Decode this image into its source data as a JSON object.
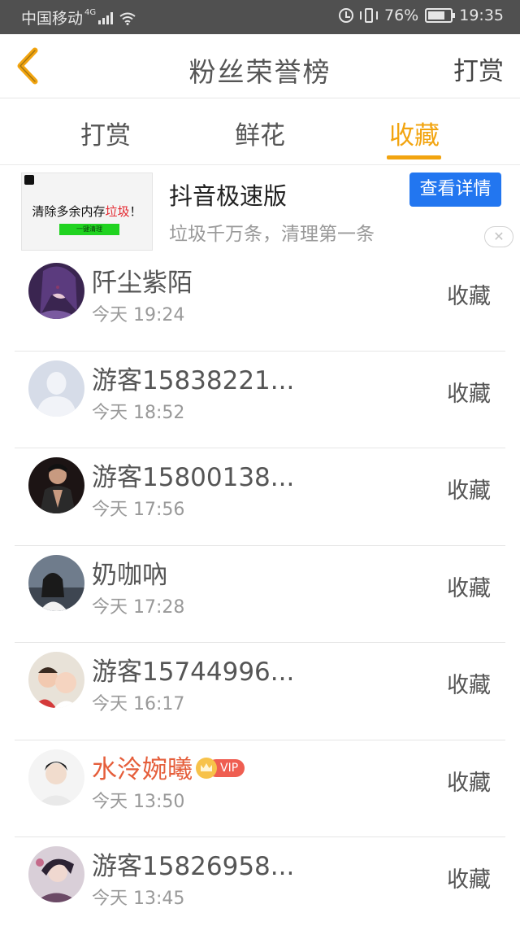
{
  "status_bar": {
    "carrier": "中国移动",
    "network": "4G",
    "battery": "76%",
    "battery_level": 0.76,
    "time": "19:35"
  },
  "header": {
    "title": "粉丝荣誉榜",
    "right_action": "打赏"
  },
  "tabs": [
    {
      "label": "打赏",
      "active": false
    },
    {
      "label": "鲜花",
      "active": false
    },
    {
      "label": "收藏",
      "active": true
    }
  ],
  "ad": {
    "image_text_main": "清除多余内存",
    "image_text_highlight": "垃圾",
    "image_text_suffix": "！",
    "image_button": "一键清理",
    "title": "抖音极速版",
    "subtitle": "垃圾千万条，清理第一条",
    "button": "查看详情"
  },
  "list": [
    {
      "name": "阡尘紫陌",
      "time": "今天 19:24",
      "action": "收藏",
      "vip": false,
      "avatar": "anime-purple-avatar"
    },
    {
      "name": "游客15838221...",
      "time": "今天 18:52",
      "action": "收藏",
      "vip": false,
      "avatar": "default-user-avatar"
    },
    {
      "name": "游客15800138...",
      "time": "今天 17:56",
      "action": "收藏",
      "vip": false,
      "avatar": "man-photo-avatar"
    },
    {
      "name": "奶咖吶",
      "time": "今天 17:28",
      "action": "收藏",
      "vip": false,
      "avatar": "girl-photo-avatar"
    },
    {
      "name": "游客15744996...",
      "time": "今天 16:17",
      "action": "收藏",
      "vip": false,
      "avatar": "kids-photo-avatar"
    },
    {
      "name": "水泠婉曦",
      "time": "今天 13:50",
      "action": "收藏",
      "vip": true,
      "vip_label": "VIP",
      "avatar": "celebrity-photo-avatar"
    },
    {
      "name": "游客15826958...",
      "time": "今天 13:45",
      "action": "收藏",
      "vip": false,
      "avatar": "anime-boy-avatar"
    }
  ],
  "colors": {
    "accent": "#f2a40f",
    "ad_button": "#2276f0",
    "vip_name": "#e55e3b",
    "status_bar_bg": "#505050"
  }
}
